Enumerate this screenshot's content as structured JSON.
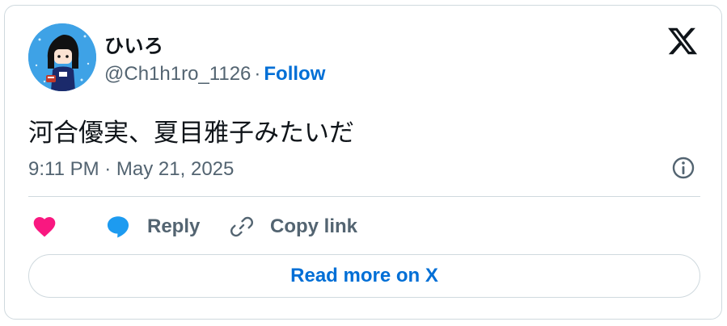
{
  "author": {
    "display_name": "ひいろ",
    "handle": "@Ch1h1ro_1126",
    "separator": "·",
    "follow_label": "Follow"
  },
  "tweet": {
    "text": "河合優実、夏目雅子みたいだ",
    "timestamp": "9:11 PM · May 21, 2025"
  },
  "actions": {
    "like_icon": "heart-icon",
    "reply_label": "Reply",
    "reply_icon": "speech-bubble-icon",
    "copy_label": "Copy link",
    "copy_icon": "link-icon"
  },
  "read_more_label": "Read more on X",
  "colors": {
    "heart": "#f91880",
    "reply_bubble": "#1d9bf0",
    "link_blue": "#006fd6",
    "muted": "#536471",
    "text": "#0f1419",
    "border": "#cfd9de"
  }
}
